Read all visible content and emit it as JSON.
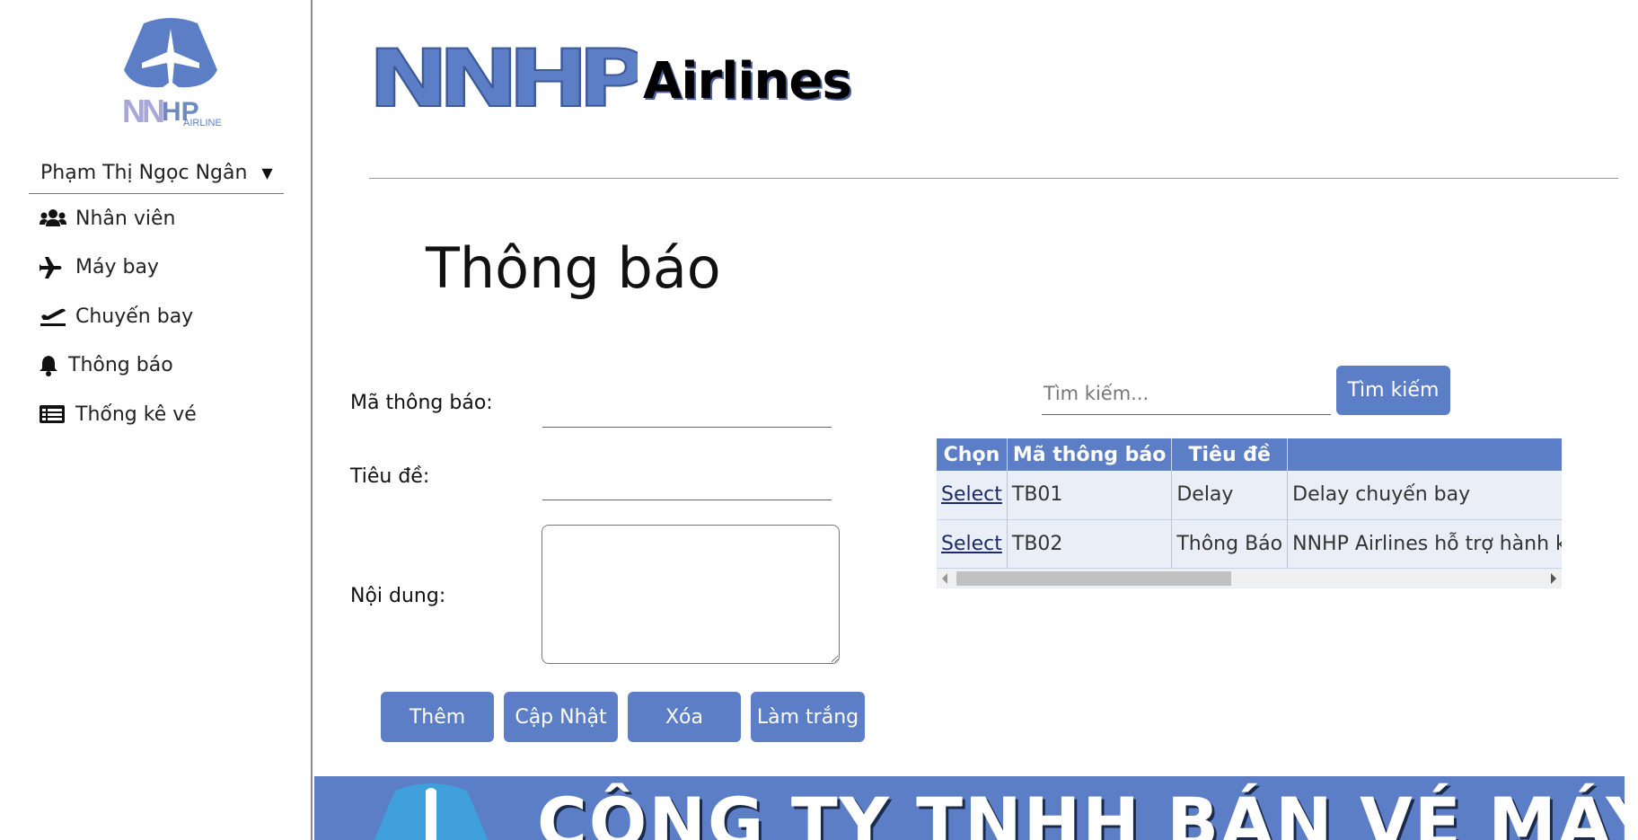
{
  "sidebar": {
    "logo_text": "NNHP",
    "logo_subtext": "AIRLINE",
    "user_name": "Phạm Thị Ngọc Ngân",
    "items": [
      {
        "label": "Nhân viên",
        "icon": "users-icon"
      },
      {
        "label": "Máy bay",
        "icon": "plane-icon"
      },
      {
        "label": "Chuyến bay",
        "icon": "plane-departure-icon"
      },
      {
        "label": "Thông báo",
        "icon": "bell-icon"
      },
      {
        "label": "Thống kê vé",
        "icon": "list-alt-icon"
      }
    ]
  },
  "header": {
    "brand_mark": "NNHP",
    "brand_text": "Airlines"
  },
  "page": {
    "title": "Thông báo"
  },
  "form": {
    "ma_label": "Mã thông báo:",
    "ma_value": "",
    "tieude_label": "Tiêu đề:",
    "tieude_value": "",
    "noidung_label": "Nội dung:",
    "noidung_value": "",
    "buttons": {
      "add": "Thêm",
      "update": "Cập Nhật",
      "delete": "Xóa",
      "clear": "Làm trắng"
    }
  },
  "search": {
    "placeholder": "Tìm kiếm...",
    "button": "Tìm kiếm"
  },
  "table": {
    "columns": [
      "Chọn",
      "Mã thông báo",
      "Tiêu đề",
      ""
    ],
    "rows": [
      {
        "select": "Select",
        "ma": "TB01",
        "tieude": "Delay",
        "noidung": "Delay chuyến bay"
      },
      {
        "select": "Select",
        "ma": "TB02",
        "tieude": "Thông Báo",
        "noidung": "NNHP Airlines hỗ trợ hành khách"
      }
    ]
  },
  "footer": {
    "banner_text": "CÔNG TY TNHH BÁN VÉ MÁY BAY"
  },
  "colors": {
    "accent": "#5b7ec6",
    "table_row_bg": "#e9eef7"
  }
}
